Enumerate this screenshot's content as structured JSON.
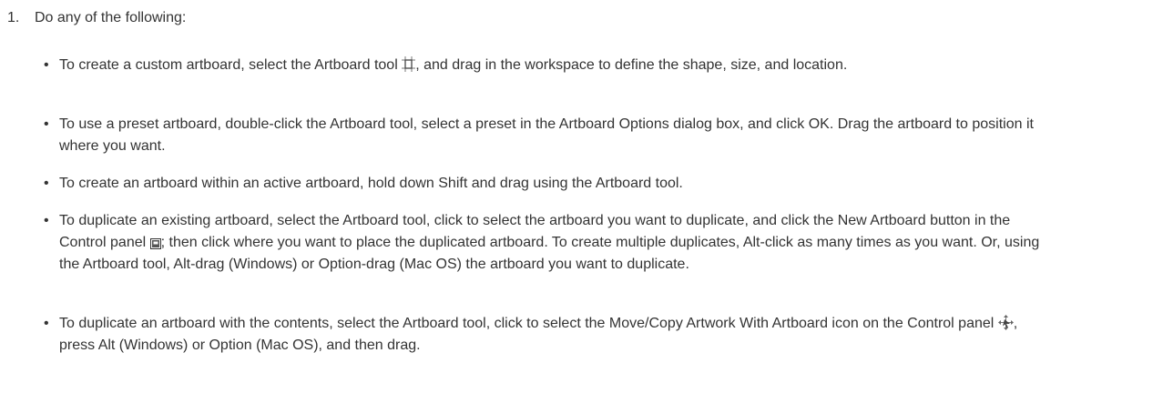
{
  "step": {
    "number": "1.",
    "text": "Do any of the following:"
  },
  "bullets": [
    {
      "before_icon": "To create a custom artboard, select the Artboard tool ",
      "icon": "artboard-tool-icon",
      "after_icon": ", and drag in the workspace to define the shape, size, and location."
    },
    {
      "text": "To use a preset artboard, double-click the Artboard tool, select a preset in the Artboard Options dialog box, and click OK. Drag the artboard to position it where you want."
    },
    {
      "text": "To create an artboard within an active artboard, hold down Shift and drag using the Artboard tool."
    },
    {
      "before_icon": "To duplicate an existing artboard, select the Artboard tool, click to select the artboard you want to duplicate, and click the New Artboard button in the Control panel ",
      "icon": "new-artboard-icon",
      "after_icon": "; then click where you want to place the duplicated artboard. To create multiple duplicates, Alt-click as many times as you want. Or, using the Artboard tool, Alt-drag (Windows) or Option-drag (Mac OS) the artboard you want to duplicate."
    },
    {
      "before_icon": "To duplicate an artboard with the contents, select the Artboard tool, click to select the Move/Copy Artwork With Artboard icon on the Control panel ",
      "icon": "move-copy-artwork-icon",
      "after_icon": ", press Alt (Windows) or Option (Mac OS), and then drag."
    }
  ],
  "bullet_symbol": "•"
}
